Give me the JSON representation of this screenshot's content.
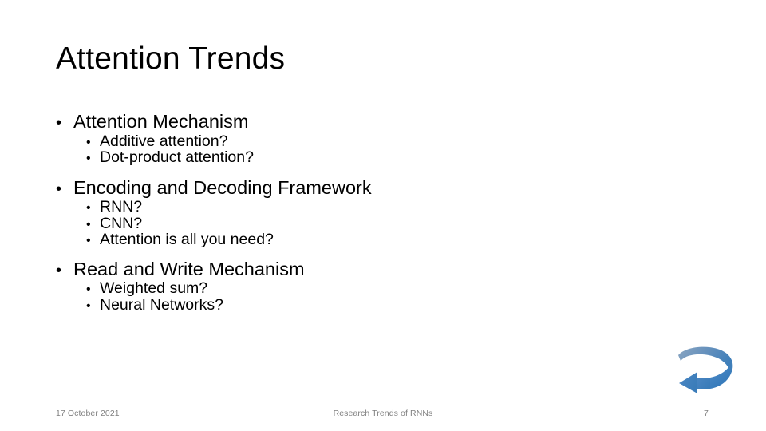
{
  "slide": {
    "title": "Attention Trends",
    "background_color": "#ffffff",
    "text_color": "#000000"
  },
  "content": {
    "groups": [
      {
        "heading": "Attention Mechanism",
        "items": [
          "Additive attention?",
          "Dot-product attention?"
        ]
      },
      {
        "heading": "Encoding and Decoding Framework",
        "items": [
          "RNN?",
          "CNN?",
          "Attention is all you need?"
        ]
      },
      {
        "heading": "Read and Write Mechanism",
        "items": [
          "Weighted sum?",
          "Neural Networks?"
        ]
      }
    ],
    "bullet_glyph_level1": "•",
    "bullet_glyph_level2": "•"
  },
  "footer": {
    "date": "17 October 2021",
    "center": "Research Trends of RNNs",
    "page_number": "7",
    "color": "#808080"
  },
  "decoration": {
    "arrow_name": "curved-arrow-icon",
    "color_light": "#7d9cbd",
    "color_mid": "#4a86c5",
    "color_dark": "#2e75b6"
  }
}
